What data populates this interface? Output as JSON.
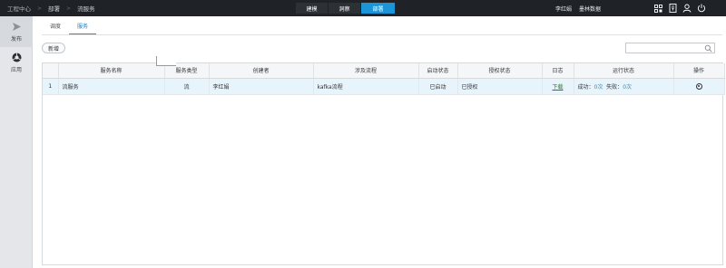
{
  "breadcrumb": {
    "items": [
      "工程中心",
      "部署",
      "流服务"
    ],
    "separator": ">"
  },
  "topnav": {
    "tabs": [
      "建模",
      "洞察",
      "部署"
    ],
    "active_index": 2
  },
  "user": {
    "name": "李红娟",
    "org": "墨林数据"
  },
  "top_icons": [
    "grid-icon",
    "book-icon",
    "user-icon",
    "power-icon"
  ],
  "sidebar": {
    "items": [
      {
        "label": "发布",
        "icon": "send-icon"
      },
      {
        "label": "应用",
        "icon": "app-icon"
      }
    ]
  },
  "subtabs": [
    "调度",
    "服务"
  ],
  "active_subtab": 1,
  "toolbar": {
    "new_label": "新增",
    "search_placeholder": "",
    "search_value": ""
  },
  "table": {
    "columns": [
      "服务名称",
      "服务类型",
      "创建者",
      "涉及流程",
      "启动状态",
      "授权状态",
      "日志",
      "运行状态",
      "操作"
    ],
    "rows": [
      {
        "index": "1",
        "name": "流服务",
        "type": "流",
        "creator": "李红娟",
        "flow": "kafka流程",
        "start_status": "已启动",
        "auth_status": "已授权",
        "log": "下载",
        "success_label": "成功：",
        "success_count": "0次",
        "fail_label": "失败：",
        "fail_count": "0次"
      }
    ]
  },
  "colors": {
    "topbar": "#1f2327",
    "accent": "#1b95d8",
    "row_highlight": "#e8f4fc"
  }
}
